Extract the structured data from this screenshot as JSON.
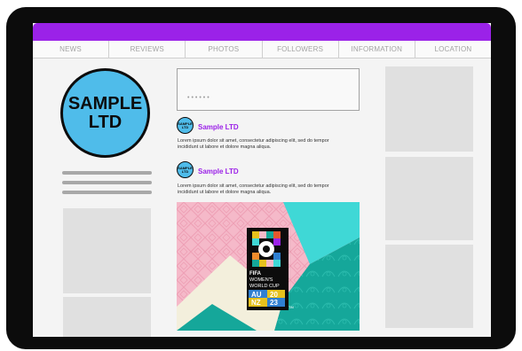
{
  "nav": {
    "items": [
      "NEWS",
      "REVIEWS",
      "PHOTOS",
      "FOLLOWERS",
      "INFORMATION",
      "LOCATION"
    ]
  },
  "profile": {
    "logo_line1": "SAMPLE",
    "logo_line2": "LTD"
  },
  "composer": {
    "placeholder": "••••••"
  },
  "posts": [
    {
      "avatar_line1": "SAMPLE",
      "avatar_line2": "LTD",
      "name": "Sample LTD",
      "text": "Lorem ipsum dolor sit amet, consectetur adipiscing elit, sed do tempor incididunt ut labore et dolore magna aliqua."
    },
    {
      "avatar_line1": "SAMPLE",
      "avatar_line2": "LTD",
      "name": "Sample LTD",
      "text": "Lorem ipsum dolor sit amet, consectetur adipiscing elit, sed do tempor incididunt ut labore et dolore magna aliqua."
    }
  ],
  "poster": {
    "line1": "FIFA",
    "line2": "WOMEN'S",
    "line3": "WORLD CUP",
    "au": "AU",
    "nz": "NZ",
    "year_top": "20",
    "year_bottom": "23",
    "tm": "TM"
  },
  "colors": {
    "accent": "#9b22e8",
    "logo_blue": "#4fbcea",
    "poster_pink": "#f5b9c9",
    "poster_teal": "#15a79a",
    "poster_cyan": "#3fd8d6"
  }
}
